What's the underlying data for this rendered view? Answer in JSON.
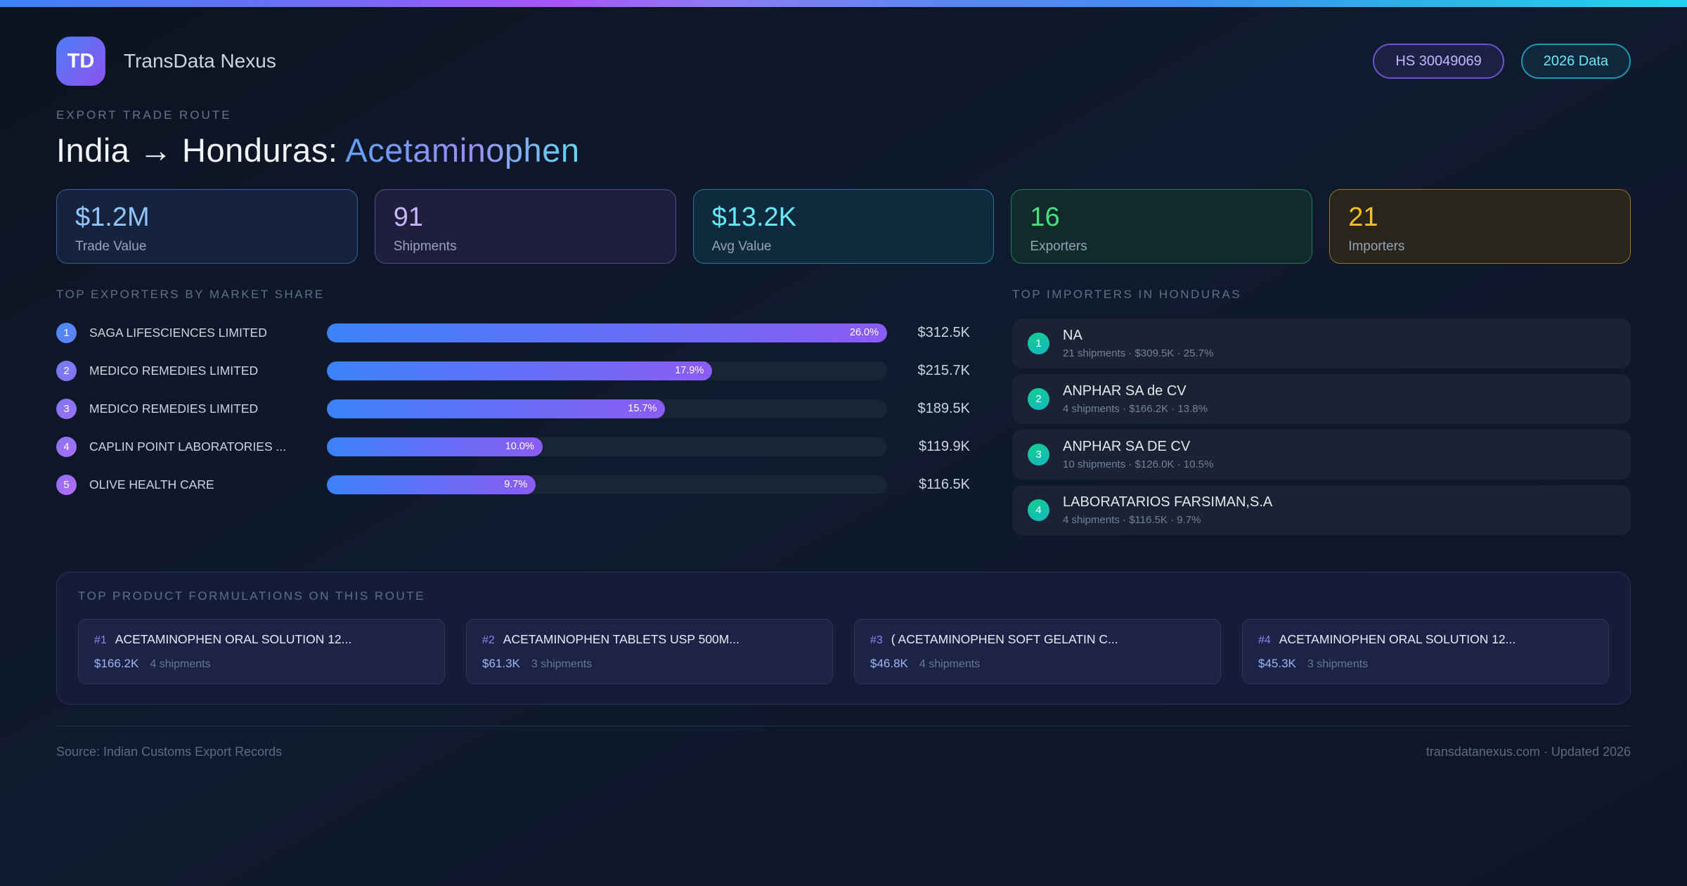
{
  "header": {
    "logo_text": "TD",
    "brand": "TransData Nexus",
    "badges": [
      {
        "label": "HS 30049069"
      },
      {
        "label": "2026 Data"
      }
    ]
  },
  "hero": {
    "kicker": "EXPORT TRADE ROUTE",
    "title_main": "India → Honduras: ",
    "title_highlight": "Acetaminophen"
  },
  "stats": [
    {
      "value": "$1.2M",
      "label": "Trade Value",
      "accent": "blue"
    },
    {
      "value": "91",
      "label": "Shipments",
      "accent": "purple"
    },
    {
      "value": "$13.2K",
      "label": "Avg Value",
      "accent": "cyan"
    },
    {
      "value": "16",
      "label": "Exporters",
      "accent": "green"
    },
    {
      "value": "21",
      "label": "Importers",
      "accent": "amber"
    }
  ],
  "exporters": {
    "heading": "TOP EXPORTERS BY MARKET SHARE",
    "max_share_pct": 26.0,
    "rows": [
      {
        "rank": "1",
        "name": "SAGA LIFESCIENCES LIMITED",
        "share_pct": 26.0,
        "share_label": "26.0%",
        "value": "$312.5K"
      },
      {
        "rank": "2",
        "name": "MEDICO REMEDIES LIMITED",
        "share_pct": 17.9,
        "share_label": "17.9%",
        "value": "$215.7K"
      },
      {
        "rank": "3",
        "name": "MEDICO REMEDIES LIMITED",
        "share_pct": 15.7,
        "share_label": "15.7%",
        "value": "$189.5K"
      },
      {
        "rank": "4",
        "name": "CAPLIN POINT LABORATORIES ...",
        "share_pct": 10.0,
        "share_label": "10.0%",
        "value": "$119.9K"
      },
      {
        "rank": "5",
        "name": "OLIVE HEALTH CARE",
        "share_pct": 9.7,
        "share_label": "9.7%",
        "value": "$116.5K"
      }
    ]
  },
  "importers": {
    "heading": "TOP IMPORTERS IN HONDURAS",
    "rows": [
      {
        "rank": "1",
        "name": "NA",
        "details": "21 shipments · $309.5K · 25.7%"
      },
      {
        "rank": "2",
        "name": "ANPHAR SA de CV",
        "details": "4 shipments · $166.2K · 13.8%"
      },
      {
        "rank": "3",
        "name": "ANPHAR SA DE CV",
        "details": "10 shipments · $126.0K · 10.5%"
      },
      {
        "rank": "4",
        "name": "LABORATARIOS  FARSIMAN,S.A",
        "details": "4 shipments · $116.5K · 9.7%"
      }
    ]
  },
  "formulations": {
    "heading": "TOP PRODUCT FORMULATIONS ON THIS ROUTE",
    "cards": [
      {
        "rank": "#1",
        "name": "ACETAMINOPHEN ORAL SOLUTION 12...",
        "value": "$166.2K",
        "shipments": "4 shipments"
      },
      {
        "rank": "#2",
        "name": "ACETAMINOPHEN TABLETS USP 500M...",
        "value": "$61.3K",
        "shipments": "3 shipments"
      },
      {
        "rank": "#3",
        "name": "( ACETAMINOPHEN SOFT GELATIN C...",
        "value": "$46.8K",
        "shipments": "4 shipments"
      },
      {
        "rank": "#4",
        "name": "ACETAMINOPHEN ORAL SOLUTION 12...",
        "value": "$45.3K",
        "shipments": "3 shipments"
      }
    ]
  },
  "footer": {
    "source": "Source: Indian Customs Export Records",
    "site": "transdatanexus.com · Updated 2026"
  },
  "colors": {
    "accent_blue": "#93c5fd",
    "accent_purple": "#c4b5fd",
    "accent_cyan": "#67e8f9",
    "accent_green": "#4ade80",
    "accent_amber": "#fbbf24",
    "bar_gradient_start": "#3b82f6",
    "bar_gradient_end": "#8b5cf6",
    "importer_badge": "#14b8a6",
    "top_bar_gradient": [
      "#3b82f6",
      "#a855f7",
      "#22d3ee"
    ]
  }
}
